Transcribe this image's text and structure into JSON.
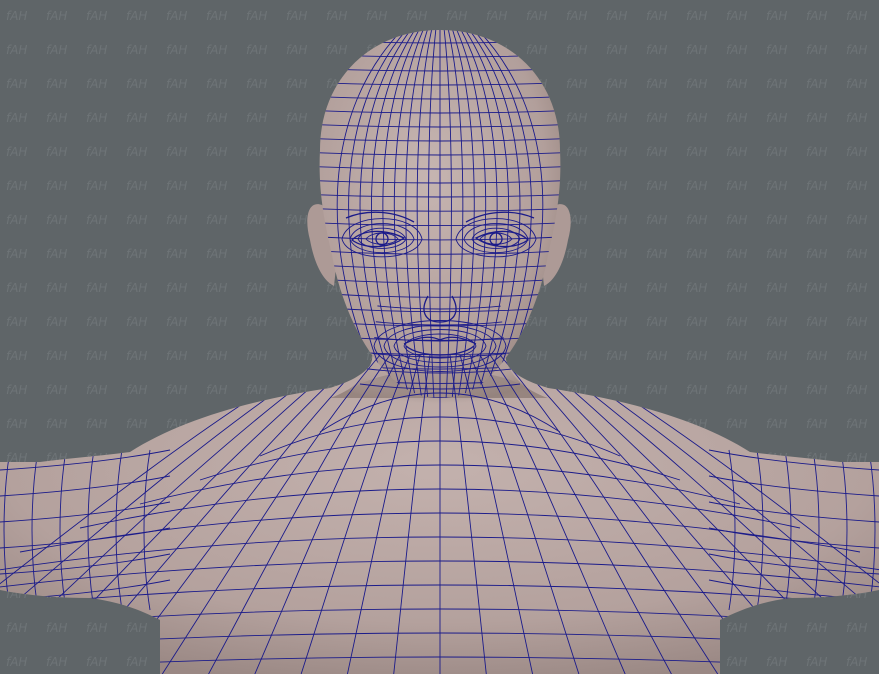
{
  "viewport": {
    "background_color": "#5f6568",
    "watermark": {
      "text": "fAH",
      "color": "#6e7477"
    }
  },
  "model": {
    "skin_color": "#b7a4a0",
    "skin_shade_color": "#8c7b78",
    "wire_color": "#1b1b8a",
    "display_mode": "wireframe-on-shaded"
  }
}
